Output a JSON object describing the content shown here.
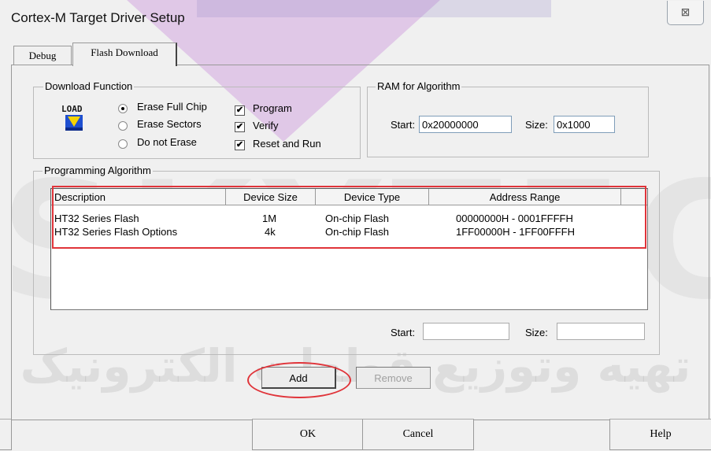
{
  "window": {
    "title": "Cortex-M Target Driver Setup",
    "close_glyph": "⊠"
  },
  "tabs": [
    {
      "label": "Debug"
    },
    {
      "label": "Flash Download"
    }
  ],
  "download_function": {
    "legend": "Download Function",
    "load_icon_text": "LOAD",
    "options": {
      "erase_full_chip": "Erase Full Chip",
      "erase_sectors": "Erase Sectors",
      "do_not_erase": "Do not Erase",
      "selected": "Erase Full Chip"
    },
    "checks": {
      "program": "Program",
      "verify": "Verify",
      "reset_and_run": "Reset and Run",
      "check_glyph": "✔"
    }
  },
  "ram": {
    "legend": "RAM for Algorithm",
    "start_label": "Start:",
    "start_value": "0x20000000",
    "size_label": "Size:",
    "size_value": "0x1000"
  },
  "programming": {
    "legend": "Programming Algorithm",
    "columns": [
      "Description",
      "Device Size",
      "Device Type",
      "Address Range"
    ],
    "rows": [
      [
        "HT32 Series Flash",
        "1M",
        "On-chip Flash",
        "00000000H - 0001FFFFH"
      ],
      [
        "HT32 Series Flash Options",
        "4k",
        "On-chip Flash",
        "1FF00000H - 1FF00FFFH"
      ]
    ],
    "start_label": "Start:",
    "start_value": "",
    "size_label": "Size:",
    "size_value": ""
  },
  "buttons": {
    "add": "Add",
    "remove": "Remove",
    "ok": "OK",
    "cancel": "Cancel",
    "help": "Help"
  },
  "watermark": {
    "text": "SKYTECH",
    "arabic": "تهيه وتوزيع قطعات الکترونيک"
  },
  "colors": {
    "highlight_red": "#e0343a"
  }
}
